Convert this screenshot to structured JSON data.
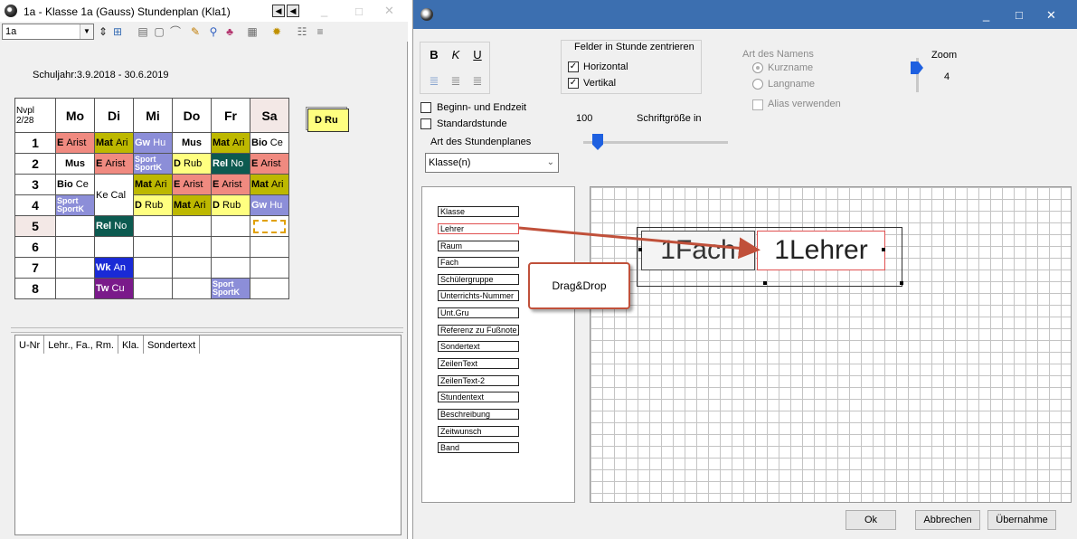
{
  "left_window": {
    "title": "1a - Klasse 1a (Gauss)  Stundenplan  (Kla1)",
    "class_select": "1a",
    "school_year": "Schuljahr:3.9.2018 - 30.6.2019",
    "corner_label_1": "Nvpl",
    "corner_label_2": "2/28",
    "days": [
      "Mo",
      "Di",
      "Mi",
      "Do",
      "Fr",
      "Sa"
    ],
    "periods": [
      "1",
      "2",
      "3",
      "4",
      "5",
      "6",
      "7",
      "8"
    ],
    "floating_lesson": "D Ru",
    "lower_columns": [
      "U-Nr",
      "Lehr., Fa., Rm.",
      "Kla.",
      "Sondertext"
    ]
  },
  "lessons": {
    "mo1": {
      "a": "E",
      "b": "Arist"
    },
    "di1": {
      "a": "Mat",
      "b": "Ari"
    },
    "mi1": {
      "a": "Gw",
      "b": "Hu"
    },
    "do1": {
      "a": "Mus",
      "b": ""
    },
    "fr1": {
      "a": "Mat",
      "b": "Ari"
    },
    "sa1": {
      "a": "Bio",
      "b": "Ce"
    },
    "mo2": {
      "a": "Mus",
      "b": ""
    },
    "di2": {
      "a": "E",
      "b": "Arist"
    },
    "mi2": {
      "a": "Sport",
      "b": "SportK"
    },
    "do2": {
      "a": "D",
      "b": "Rub"
    },
    "fr2": {
      "a": "Rel",
      "b": "No"
    },
    "sa2": {
      "a": "E",
      "b": "Arist"
    },
    "mo3": {
      "a": "Bio",
      "b": "Ce"
    },
    "di34": {
      "a": "Ke",
      "b": "Cal"
    },
    "mi3": {
      "a": "Mat",
      "b": "Ari"
    },
    "do3": {
      "a": "E",
      "b": "Arist"
    },
    "fr3": {
      "a": "E",
      "b": "Arist"
    },
    "sa3": {
      "a": "Mat",
      "b": "Ari"
    },
    "mo4": {
      "a": "Sport",
      "b": "SportK"
    },
    "mi4": {
      "a": "D",
      "b": "Rub"
    },
    "do4": {
      "a": "Mat",
      "b": "Ari"
    },
    "fr4": {
      "a": "D",
      "b": "Rub"
    },
    "sa4": {
      "a": "Gw",
      "b": "Hu"
    },
    "di5": {
      "a": "Rel",
      "b": "No"
    },
    "di7": {
      "a": "Wk",
      "b": "An"
    },
    "di8": {
      "a": "Tw",
      "b": "Cu"
    },
    "fr8": {
      "a": "Sport",
      "b": "SportK"
    }
  },
  "right_window": {
    "format_bold": "B",
    "format_italic": "K",
    "format_underline": "U",
    "center_group_title": "Felder in Stunde zentrieren",
    "center_horizontal": "Horizontal",
    "center_vertical": "Vertikal",
    "center_horizontal_checked": true,
    "center_vertical_checked": true,
    "name_group_title": "Art des Namens",
    "name_short": "Kurzname",
    "name_long": "Langname",
    "alias": "Alias verwenden",
    "zoom_label": "Zoom",
    "zoom_value": "4",
    "begin_end": "Beginn- und Endzeit",
    "standard_lesson": "Standardstunde",
    "font_size_value": "100",
    "font_size_label": "Schriftgröße in",
    "plan_type_label": "Art des Stundenplanes",
    "plan_type_value": "Klasse(n)",
    "fields": [
      "Klasse",
      "Lehrer",
      "Raum",
      "Fach",
      "Schülergruppe",
      "Unterrichts-Nummer",
      "Unt.Gru",
      "Referenz zu Fußnote",
      "Sondertext",
      "ZeilenText",
      "ZeilenText-2",
      "Stundentext",
      "Beschreibung",
      "Zeitwunsch",
      "Band"
    ],
    "canvas_field_fach": "1Fach",
    "canvas_field_lehrer": "1Lehrer",
    "callout": "Drag&Drop",
    "btn_ok": "Ok",
    "btn_cancel": "Abbrechen",
    "btn_apply": "Übernahme"
  },
  "colors": {
    "salmon": "#f08a80",
    "olive": "#bdb800",
    "periwinkle": "#8c8ed8",
    "teal": "#0c5a50",
    "yellow": "#ffff80",
    "blue": "#1a2ad6",
    "purple": "#7a1a8a",
    "title_blue": "#3c6fb0",
    "callout_border": "#c0503a"
  },
  "icons": [
    "app-icon",
    "nav-left-icon",
    "nav-right-icon",
    "minimize-icon",
    "maximize-icon",
    "close-icon",
    "combo-down-icon",
    "spin-icon",
    "grid-icon",
    "print-icon",
    "lock-icon",
    "pencil-icon",
    "search-icon",
    "person-icon",
    "settings-icon",
    "gear-icon",
    "list-icon"
  ]
}
